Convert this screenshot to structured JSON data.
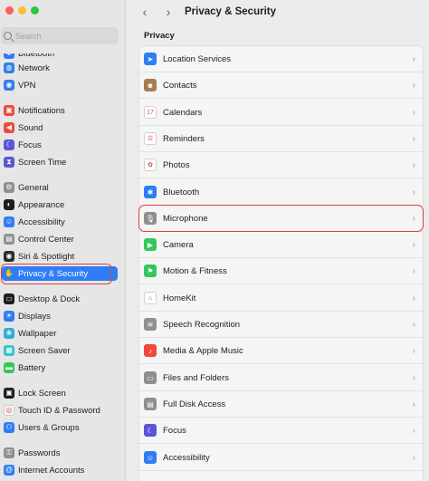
{
  "window": {
    "title": "Privacy & Security"
  },
  "search": {
    "placeholder": "Search"
  },
  "toolbar": {
    "back": "‹",
    "forward": "›",
    "title": "Privacy & Security"
  },
  "sidebar": {
    "items": [
      {
        "label": "Bluetooth",
        "icon": "bluetooth-icon",
        "color": "#2f7df6",
        "glyph": "✱"
      },
      {
        "label": "Network",
        "icon": "globe-icon",
        "color": "#2f7df6",
        "glyph": "◍"
      },
      {
        "label": "VPN",
        "icon": "vpn-icon",
        "color": "#2f7df6",
        "glyph": "◉"
      },
      {
        "label": "Notifications",
        "icon": "bell-icon",
        "color": "#f0483e",
        "glyph": "▣"
      },
      {
        "label": "Sound",
        "icon": "speaker-icon",
        "color": "#f0483e",
        "glyph": "◀"
      },
      {
        "label": "Focus",
        "icon": "moon-icon",
        "color": "#5a55d6",
        "glyph": "☾"
      },
      {
        "label": "Screen Time",
        "icon": "hourglass-icon",
        "color": "#5a55d6",
        "glyph": "⧗"
      },
      {
        "label": "General",
        "icon": "gear-icon",
        "color": "#8e8e93",
        "glyph": "⚙"
      },
      {
        "label": "Appearance",
        "icon": "appearance-icon",
        "color": "#1d1d1f",
        "glyph": "◐"
      },
      {
        "label": "Accessibility",
        "icon": "accessibility-icon",
        "color": "#2f7df6",
        "glyph": "☺"
      },
      {
        "label": "Control Center",
        "icon": "control-center-icon",
        "color": "#8e8e93",
        "glyph": "▤"
      },
      {
        "label": "Siri & Spotlight",
        "icon": "siri-icon",
        "color": "#2a2a2a",
        "glyph": "◉"
      },
      {
        "label": "Privacy & Security",
        "icon": "hand-icon",
        "color": "#2f7df6",
        "glyph": "✋"
      },
      {
        "label": "Desktop & Dock",
        "icon": "dock-icon",
        "color": "#1d1d1f",
        "glyph": "▭"
      },
      {
        "label": "Displays",
        "icon": "sun-icon",
        "color": "#2f7df6",
        "glyph": "☀"
      },
      {
        "label": "Wallpaper",
        "icon": "wallpaper-icon",
        "color": "#34aadc",
        "glyph": "❀"
      },
      {
        "label": "Screen Saver",
        "icon": "screen-saver-icon",
        "color": "#34c6c8",
        "glyph": "▦"
      },
      {
        "label": "Battery",
        "icon": "battery-icon",
        "color": "#34c759",
        "glyph": "▬"
      },
      {
        "label": "Lock Screen",
        "icon": "lock-icon",
        "color": "#1d1d1f",
        "glyph": "▣"
      },
      {
        "label": "Touch ID & Password",
        "icon": "fingerprint-icon",
        "color": "#f7f7f7",
        "glyph": "◎"
      },
      {
        "label": "Users & Groups",
        "icon": "users-icon",
        "color": "#2f7df6",
        "glyph": "⚇"
      },
      {
        "label": "Passwords",
        "icon": "key-icon",
        "color": "#8e8e93",
        "glyph": "⚿"
      },
      {
        "label": "Internet Accounts",
        "icon": "at-icon",
        "color": "#2f7df6",
        "glyph": "@"
      }
    ],
    "selected": "Privacy & Security"
  },
  "main": {
    "section_title": "Privacy",
    "rows": [
      {
        "label": "Location Services",
        "icon": "location-arrow-icon",
        "color": "#2f7df6",
        "glyph": "➤"
      },
      {
        "label": "Contacts",
        "icon": "contacts-book-icon",
        "color": "#a77c52",
        "glyph": "☻"
      },
      {
        "label": "Calendars",
        "icon": "calendar-icon",
        "color": "#ffffff",
        "glyph": "17"
      },
      {
        "label": "Reminders",
        "icon": "reminders-list-icon",
        "color": "#ffffff",
        "glyph": "☰"
      },
      {
        "label": "Photos",
        "icon": "photos-flower-icon",
        "color": "#ffffff",
        "glyph": "✿"
      },
      {
        "label": "Bluetooth",
        "icon": "bluetooth-icon",
        "color": "#2f7df6",
        "glyph": "✱"
      },
      {
        "label": "Microphone",
        "icon": "microphone-icon",
        "color": "#8e8e93",
        "glyph": "🎙"
      },
      {
        "label": "Camera",
        "icon": "camera-icon",
        "color": "#34c759",
        "glyph": "▶"
      },
      {
        "label": "Motion & Fitness",
        "icon": "fitness-icon",
        "color": "#34c759",
        "glyph": "⚑"
      },
      {
        "label": "HomeKit",
        "icon": "home-icon",
        "color": "#ffffff",
        "glyph": "⌂"
      },
      {
        "label": "Speech Recognition",
        "icon": "waveform-icon",
        "color": "#8e8e93",
        "glyph": "≋"
      },
      {
        "label": "Media & Apple Music",
        "icon": "music-note-icon",
        "color": "#f0483e",
        "glyph": "♪"
      },
      {
        "label": "Files and Folders",
        "icon": "folder-icon",
        "color": "#8e8e93",
        "glyph": "▭"
      },
      {
        "label": "Full Disk Access",
        "icon": "disk-icon",
        "color": "#8e8e93",
        "glyph": "▤"
      },
      {
        "label": "Focus",
        "icon": "moon-icon",
        "color": "#5a55d6",
        "glyph": "☾"
      },
      {
        "label": "Accessibility",
        "icon": "accessibility-icon",
        "color": "#2f7df6",
        "glyph": "☺"
      }
    ],
    "highlighted": "Microphone"
  }
}
